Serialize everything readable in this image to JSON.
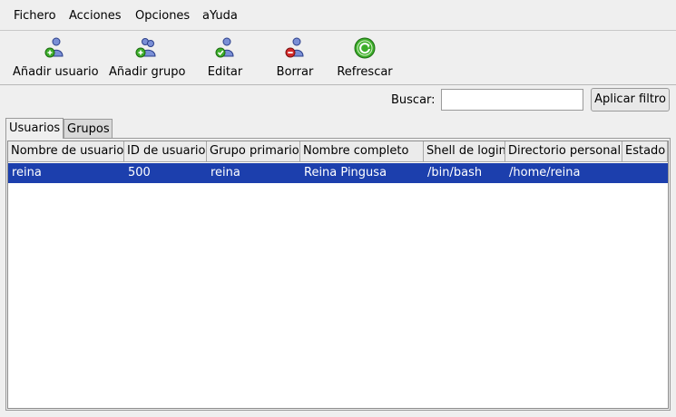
{
  "menu": [
    {
      "label": "Fichero"
    },
    {
      "label": "Acciones"
    },
    {
      "label": "Opciones"
    },
    {
      "label": "aYuda"
    }
  ],
  "toolbar": {
    "add_user": "Añadir usuario",
    "add_group": "Añadir grupo",
    "edit": "Editar",
    "delete": "Borrar",
    "refresh": "Refrescar"
  },
  "filter": {
    "label": "Buscar:",
    "value": "",
    "button": "Aplicar filtro"
  },
  "tabs": [
    {
      "label": "Usuarios",
      "active": true
    },
    {
      "label": "Grupos",
      "active": false
    }
  ],
  "table": {
    "columns": [
      "Nombre de usuario",
      "ID de usuario",
      "Grupo primario",
      "Nombre completo",
      "Shell de login",
      "Directorio personal",
      "Estado"
    ],
    "rows": [
      {
        "selected": true,
        "cells": [
          "reina",
          "500",
          "reina",
          "Reina Pingusa",
          "/bin/bash",
          "/home/reina",
          ""
        ]
      }
    ]
  },
  "colors": {
    "selection": "#1c3fad",
    "icon_user": "#7a8fd6",
    "icon_add": "#3cae2a",
    "icon_delete": "#d42a2a"
  },
  "icons": {
    "add_user": "user-add-icon",
    "add_group": "group-add-icon",
    "edit": "user-edit-icon",
    "delete": "user-delete-icon",
    "refresh": "refresh-icon"
  }
}
